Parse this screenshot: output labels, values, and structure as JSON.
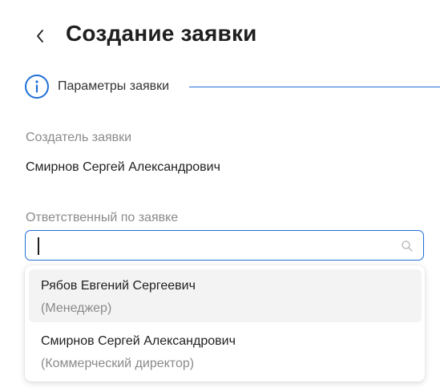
{
  "header": {
    "title": "Создание заявки",
    "back_icon": "chevron-left-icon"
  },
  "step": {
    "icon": "info-icon",
    "label": "Параметры заявки",
    "accent_color": "#1f6fd6"
  },
  "creator": {
    "label": "Создатель заявки",
    "value": "Смирнов Сергей Александрович"
  },
  "responsible": {
    "label": "Ответственный по заявке",
    "input_value": "",
    "search_icon": "search-icon"
  },
  "dropdown": {
    "options": [
      {
        "name": "Рябов Евгений Сергеевич",
        "role": "(Менеджер)",
        "highlighted": true
      },
      {
        "name": "Смирнов Сергей Александрович",
        "role": "(Коммерческий директор)",
        "highlighted": false
      }
    ]
  }
}
